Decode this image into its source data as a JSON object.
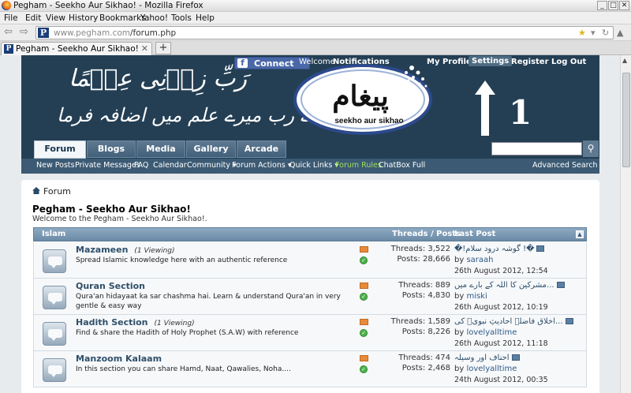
{
  "browser": {
    "title": "Pegham - Seekho Aur Sikhao! - Mozilla Firefox",
    "menu": [
      "File",
      "Edit",
      "View",
      "History",
      "Bookmarks",
      "Yahoo!",
      "Tools",
      "Help"
    ],
    "url_host": "www.pegham.com",
    "url_path": "/forum.php",
    "tab_title": "Pegham - Seekho Aur Sikhao!",
    "new_tab": "+",
    "fav_letter": "P"
  },
  "header": {
    "facebook_connect": "Connect",
    "top_links": [
      "Welcome",
      "Notifications",
      "My Profile",
      "Settings",
      "Register",
      "Log Out"
    ],
    "calligraphy_line1": "رَبِّ زِدۡنِی عِلۡمًا",
    "calligraphy_line2": "اے رب میرے علم میں اضافہ فرما",
    "logo_urdu": "پیغام",
    "logo_tagline": "seekho aur sikhao",
    "annotation_number": "1",
    "nav_tabs": [
      "Forum",
      "Blogs",
      "Media",
      "Gallery",
      "Arcade"
    ],
    "sub_nav": [
      "New Posts",
      "Private Messages",
      "FAQ",
      "Calendar",
      "Community",
      "Forum Actions",
      "Quick Links",
      "Forum Rules",
      "ChatBox Full"
    ],
    "advanced_search": "Advanced Search",
    "search_placeholder": ""
  },
  "content": {
    "breadcrumb": "Forum",
    "heading": "Pegham - Seekho Aur Sikhao!",
    "welcome": "Welcome to the Pegham - Seekho Aur Sikhao!.",
    "section": {
      "name": "Islam",
      "col_threads": "Threads / Posts",
      "col_last": "Last Post"
    },
    "forums": [
      {
        "title": "Mazameen",
        "viewing": "(1 Viewing)",
        "desc": "Spread Islamic knowledge here with an authentic reference",
        "threads": "Threads: 3,522",
        "posts": "Posts: 28,666",
        "last_title": "�!گوشہ درود سلام !�",
        "by": "by",
        "last_user": "saraah",
        "last_date": "26th August 2012, 12:54"
      },
      {
        "title": "Quran Section",
        "viewing": "",
        "desc": "Qura'an hidayaat ka sar chashma hai. Learn & understand Qura'an in very gentle & easy way",
        "threads": "Threads: 889",
        "posts": "Posts: 4,830",
        "last_title": "مشرکین کا اللہ کے بارے میں...",
        "by": "by",
        "last_user": "miski",
        "last_date": "26th August 2012, 10:19"
      },
      {
        "title": "Hadith Section",
        "viewing": "(1 Viewing)",
        "desc": "Find & share the Hadith of Holy Prophet (S.A.W) with reference",
        "threads": "Threads: 1,589",
        "posts": "Posts: 8,226",
        "last_title": "اخلاق فاضلہ احادیثِ نبویؐ کی...",
        "by": "by",
        "last_user": "lovelyalltime",
        "last_date": "26th August 2012, 11:18"
      },
      {
        "title": "Manzoom Kalaam",
        "viewing": "",
        "desc": "In this section you can share Hamd, Naat, Qawalies, Noha....",
        "threads": "Threads: 474",
        "posts": "Posts: 2,468",
        "last_title": "احناف اور وسیلہ",
        "by": "by",
        "last_user": "lovelyalltime",
        "last_date": "24th August 2012, 00:35"
      }
    ]
  }
}
